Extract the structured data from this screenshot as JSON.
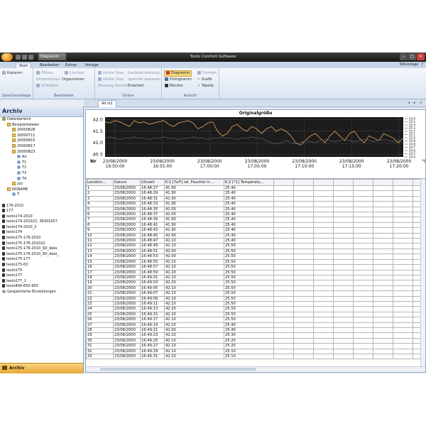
{
  "titlebar": {
    "doc_tab": "Diagramm",
    "app_title": "Testo Comfort-Software",
    "win_min": "–",
    "win_max": "□",
    "win_close": "×"
  },
  "ribbon_tabs": [
    "Start",
    "Bearbeiten",
    "Extras",
    "Vorlage"
  ],
  "ribbon_right": {
    "label": "Stilvorlage",
    "help": "?"
  },
  "ribbon": {
    "groups": {
      "zwischenablage": {
        "label": "Zwischenablage",
        "kopieren": "Kopieren"
      },
      "bearbeiten": {
        "label": "Bearbeiten",
        "offnen": "Öffnen",
        "loschen": "Löschen",
        "umbenennen": "Umbenennen",
        "organisieren": "Organisieren",
        "schliessen": "Schließen"
      },
      "online": {
        "label": "Online",
        "online_start": "Online Start",
        "online_stop": "Online Stop",
        "gerateeinstellung": "Geräteeinstellung",
        "speicher": "Speicher auslesen",
        "messung": "Messung Steuern",
        "erweitert": "Erweitert"
      },
      "ansicht": {
        "label": "Ansicht",
        "diagramm": "Diagramm",
        "histogramm": "Histogramm",
        "monitor": "Monitor",
        "formeln": "Formeln",
        "grafik": "Grafik",
        "tabelle": "Tabelle"
      }
    }
  },
  "left": {
    "title": "Archiv",
    "footer": "Archiv",
    "tree": [
      {
        "label": "Datenbereich",
        "indent": 0,
        "icon": "db"
      },
      {
        "label": "Beispieldateien",
        "indent": 1,
        "icon": "folder"
      },
      {
        "label": "20000828",
        "indent": 2,
        "icon": "folder"
      },
      {
        "label": "20000711",
        "indent": 2,
        "icon": "folder"
      },
      {
        "label": "20000815",
        "indent": 2,
        "icon": "folder"
      },
      {
        "label": "20000817",
        "indent": 2,
        "icon": "folder"
      },
      {
        "label": "20000823",
        "indent": 2,
        "icon": "folder"
      },
      {
        "label": "Air",
        "indent": 3,
        "icon": "sensor"
      },
      {
        "label": "T1",
        "indent": 3,
        "icon": "sensor"
      },
      {
        "label": "T2",
        "indent": 3,
        "icon": "sensor"
      },
      {
        "label": "T3",
        "indent": 3,
        "icon": "sensor"
      },
      {
        "label": "T4",
        "indent": 3,
        "icon": "sensor"
      },
      {
        "label": "zzz",
        "indent": 2,
        "icon": "folder"
      },
      {
        "label": "NONAME",
        "indent": 1,
        "icon": "folder"
      },
      {
        "label": "Т",
        "indent": 2,
        "icon": "sensor"
      },
      {
        "label": "",
        "indent": 0,
        "icon": ""
      },
      {
        "label": "176-2010",
        "indent": 0,
        "icon": "dev"
      },
      {
        "label": "177",
        "indent": 0,
        "icon": "dev"
      },
      {
        "label": "testo174-2010",
        "indent": 0,
        "icon": "dev"
      },
      {
        "label": "testo174-201022; 36301057",
        "indent": 0,
        "icon": "dev"
      },
      {
        "label": "testo174-2010_2",
        "indent": 0,
        "icon": "dev"
      },
      {
        "label": "testo174",
        "indent": 0,
        "icon": "dev"
      },
      {
        "label": "testo175-176-2010",
        "indent": 0,
        "icon": "dev"
      },
      {
        "label": "testo175-176-201022",
        "indent": 0,
        "icon": "dev"
      },
      {
        "label": "testo175-176-2010_SD_data",
        "indent": 0,
        "icon": "dev"
      },
      {
        "label": "testo175-176-2010_SD_data_",
        "indent": 0,
        "icon": "dev"
      },
      {
        "label": "testo175-177",
        "indent": 0,
        "icon": "dev"
      },
      {
        "label": "testo175-63",
        "indent": 0,
        "icon": "dev"
      },
      {
        "label": "testo175",
        "indent": 0,
        "icon": "dev"
      },
      {
        "label": "testo177",
        "indent": 0,
        "icon": "dev"
      },
      {
        "label": "testo177_1",
        "indent": 0,
        "icon": "dev"
      },
      {
        "label": "testo400-650-950",
        "indent": 0,
        "icon": "dev"
      },
      {
        "label": "Gespeicherte Einstellungen",
        "indent": 0,
        "icon": "gear"
      }
    ]
  },
  "doc": {
    "tab": "Air.vi2",
    "nav": "◂ ▸ ×"
  },
  "chart_data": {
    "type": "line",
    "title": "Originalgröße",
    "ylabel_left": "Nr",
    "ylabel_right": "°C",
    "y_ticks": [
      "42.0",
      "41.5",
      "41.0",
      "40.5"
    ],
    "ylim": [
      40.4,
      42.1
    ],
    "x_ticks": [
      {
        "date": "23/08/2000",
        "time": "16:50:00"
      },
      {
        "date": "23/08/2000",
        "time": "16:55:00"
      },
      {
        "date": "23/08/2000",
        "time": "17:00:00"
      },
      {
        "date": "23/08/2000",
        "time": "17:05:00"
      },
      {
        "date": "23/08/2000",
        "time": "17:10:00"
      },
      {
        "date": "23/08/2000",
        "time": "17:15:00"
      },
      {
        "date": "23/08/2000",
        "time": "17:20:00"
      }
    ],
    "right_scale": [
      "25.6",
      "25.5",
      "25.4",
      "25.3",
      "25.2",
      "25.1",
      "25.0",
      "24.9",
      "24.8",
      "24.7",
      "24.6",
      "24.5",
      "24.4"
    ],
    "series": [
      {
        "color": "#d49a5a",
        "values": [
          41.9,
          41.85,
          41.95,
          41.9,
          41.8,
          41.7,
          41.95,
          41.85,
          41.9,
          41.8,
          41.85,
          41.9,
          41.95,
          41.8,
          41.7,
          41.85,
          41.9,
          41.95,
          41.85,
          41.6,
          41.7,
          41.85,
          41.9,
          41.5,
          41.3,
          41.4,
          41.7,
          41.8,
          41.6,
          41.5,
          41.7,
          41.6,
          41.4,
          41.6,
          41.7,
          41.5,
          41.6,
          41.5,
          41.3,
          41.0,
          40.9,
          41.1,
          41.3,
          41.4,
          41.2,
          41.0,
          41.3,
          41.5,
          41.3,
          41.1,
          41.4,
          41.5,
          41.2,
          41.0,
          41.3,
          41.2,
          41.1,
          41.4,
          41.3,
          41.2,
          41.0,
          41.2
        ]
      },
      {
        "color": "#555555",
        "values": [
          41.2,
          41.25,
          41.2,
          41.15,
          41.2,
          41.2,
          41.25,
          41.2,
          41.2,
          41.15,
          41.2,
          41.2,
          41.25,
          41.2,
          41.2,
          41.15,
          41.2,
          41.2,
          41.25,
          41.2,
          41.2,
          41.15,
          41.2,
          41.2,
          41.25,
          41.2,
          41.2,
          41.15,
          41.2,
          41.2,
          41.25,
          41.2,
          41.2,
          41.1,
          41.0,
          40.95,
          41.0,
          41.1,
          41.0,
          40.95,
          41.0,
          41.1,
          41.05,
          41.0,
          41.1,
          41.15,
          41.1,
          41.05,
          41.1,
          41.15,
          41.1,
          41.05,
          41.1,
          41.15,
          41.1,
          41.05,
          41.1,
          41.15,
          41.1,
          41.05,
          41.1,
          41.15
        ]
      }
    ]
  },
  "table": {
    "headers": [
      "Lenzkirc...",
      "Datum",
      "Uhrzeit",
      "K:1 [%rF] rel. Feuchte in ...",
      "K:2 [°C] Temperatu..."
    ],
    "rows": [
      [
        "1",
        "23/08/2000",
        "16:48:27",
        "41.90",
        "25.40"
      ],
      [
        "2",
        "23/08/2000",
        "16:48:29",
        "41.90",
        "25.40"
      ],
      [
        "3",
        "23/08/2000",
        "16:48:31",
        "41.90",
        "25.40"
      ],
      [
        "4",
        "23/08/2000",
        "16:48:33",
        "41.90",
        "25.40"
      ],
      [
        "5",
        "23/08/2000",
        "16:48:35",
        "42.00",
        "25.40"
      ],
      [
        "6",
        "23/08/2000",
        "16:48:37",
        "42.00",
        "25.40"
      ],
      [
        "7",
        "23/08/2000",
        "16:48:39",
        "41.90",
        "25.40"
      ],
      [
        "8",
        "23/08/2000",
        "16:48:41",
        "41.90",
        "25.40"
      ],
      [
        "9",
        "23/08/2000",
        "16:48:43",
        "41.90",
        "25.40"
      ],
      [
        "10",
        "23/08/2000",
        "16:48:45",
        "42.00",
        "25.40"
      ],
      [
        "11",
        "23/08/2000",
        "16:48:47",
        "42.10",
        "25.40"
      ],
      [
        "12",
        "23/08/2000",
        "16:48:49",
        "42.10",
        "25.50"
      ],
      [
        "13",
        "23/08/2000",
        "16:48:51",
        "42.00",
        "25.50"
      ],
      [
        "14",
        "23/08/2000",
        "16:48:53",
        "42.00",
        "25.50"
      ],
      [
        "15",
        "23/08/2000",
        "16:48:55",
        "42.10",
        "25.50"
      ],
      [
        "16",
        "23/08/2000",
        "16:48:57",
        "42.10",
        "25.50"
      ],
      [
        "17",
        "23/08/2000",
        "16:48:59",
        "42.20",
        "25.50"
      ],
      [
        "18",
        "23/08/2000",
        "16:49:01",
        "42.20",
        "25.50"
      ],
      [
        "19",
        "23/08/2000",
        "16:49:03",
        "42.20",
        "25.50"
      ],
      [
        "20",
        "23/08/2000",
        "16:49:05",
        "42.10",
        "25.50"
      ],
      [
        "21",
        "23/08/2000",
        "16:49:07",
        "42.10",
        "25.50"
      ],
      [
        "22",
        "23/08/2000",
        "16:49:09",
        "42.10",
        "25.50"
      ],
      [
        "23",
        "23/08/2000",
        "16:49:11",
        "42.10",
        "25.50"
      ],
      [
        "24",
        "23/08/2000",
        "16:49:13",
        "42.20",
        "25.50"
      ],
      [
        "25",
        "23/08/2000",
        "16:49:15",
        "42.20",
        "25.50"
      ],
      [
        "26",
        "23/08/2000",
        "16:49:17",
        "42.10",
        "25.50"
      ],
      [
        "27",
        "23/08/2000",
        "16:49:19",
        "42.10",
        "25.40"
      ],
      [
        "28",
        "23/08/2000",
        "16:49:21",
        "42.00",
        "25.40"
      ],
      [
        "29",
        "23/08/2000",
        "16:49:23",
        "42.10",
        "25.30"
      ],
      [
        "30",
        "23/08/2000",
        "16:49:25",
        "42.10",
        "25.20"
      ],
      [
        "31",
        "23/08/2000",
        "16:49:27",
        "42.10",
        "25.20"
      ],
      [
        "32",
        "23/08/2000",
        "16:49:29",
        "42.10",
        "25.10"
      ],
      [
        "33",
        "23/08/2000",
        "16:49:31",
        "42.10",
        "25.10"
      ]
    ]
  }
}
